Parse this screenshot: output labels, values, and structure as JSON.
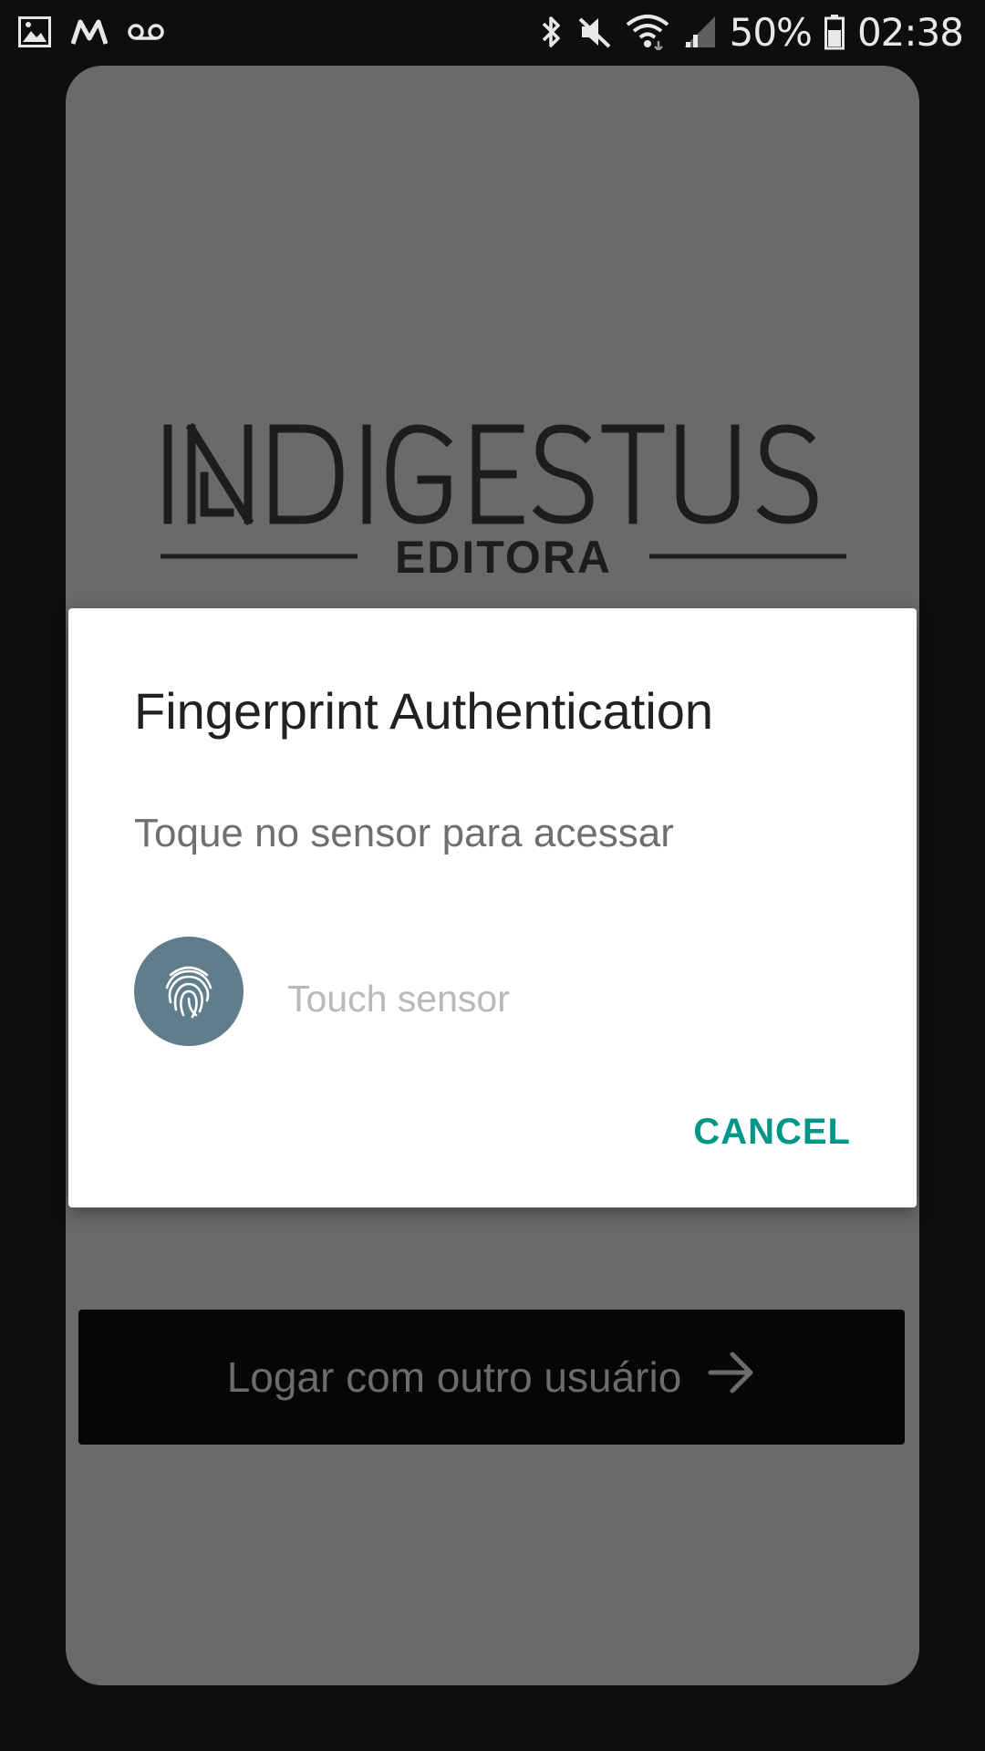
{
  "status_bar": {
    "notification_icons": [
      "image-icon",
      "m-app-icon",
      "voicemail-icon"
    ],
    "system_icons": [
      "bluetooth-icon",
      "mute-icon",
      "wifi-icon",
      "signal-icon"
    ],
    "battery_percent": "50%",
    "time": "02:38"
  },
  "app": {
    "logo": {
      "brand": "INDIGESTUS",
      "subtitle": "EDITORA"
    },
    "other_user_button": {
      "label": "Logar com outro usuário",
      "icon": "arrow-right-icon"
    }
  },
  "dialog": {
    "title": "Fingerprint Authentication",
    "description": "Toque no sensor para acessar",
    "fingerprint_icon": "fingerprint-icon",
    "status": "Touch sensor",
    "cancel_label": "CANCEL",
    "accent_color": "#009688",
    "icon_bg_color": "#607d8b"
  }
}
